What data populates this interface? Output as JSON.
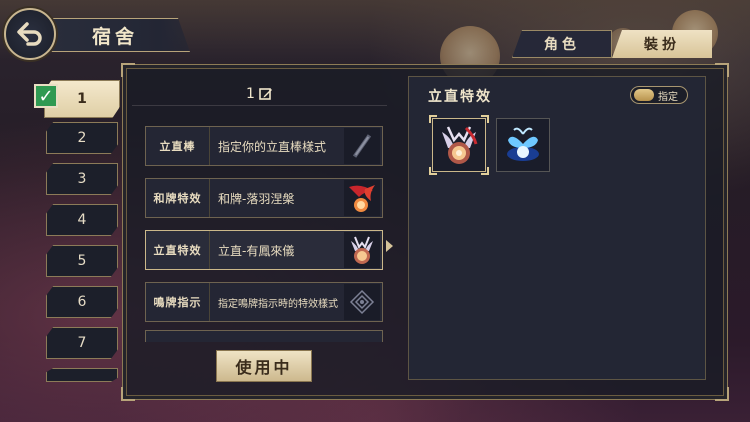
{
  "header": {
    "title": "宿舍"
  },
  "tabs": [
    {
      "label": "角色",
      "active": false
    },
    {
      "label": "裝扮",
      "active": true
    }
  ],
  "slots": [
    {
      "label": "1",
      "active": true
    },
    {
      "label": "2"
    },
    {
      "label": "3"
    },
    {
      "label": "4"
    },
    {
      "label": "5"
    },
    {
      "label": "6"
    },
    {
      "label": "7"
    }
  ],
  "loadout": {
    "name": "1"
  },
  "items": [
    {
      "category": "立直棒",
      "value": "指定你的立直棒樣式",
      "thumb_icon": "stick-icon"
    },
    {
      "category": "和牌特效",
      "value": "和牌-落羽涅槃",
      "thumb_icon": "phoenix-effect-icon"
    },
    {
      "category": "立直特效",
      "value": "立直-有鳳來儀",
      "thumb_icon": "phoenix-orb-icon",
      "selected": true
    },
    {
      "category": "鳴牌指示",
      "value": "指定鳴牌指示時的特效樣式",
      "thumb_icon": "call-indicator-icon"
    }
  ],
  "use_button": {
    "label": "使用中"
  },
  "effect_panel": {
    "title": "立直特效",
    "assign_label": "指定",
    "options": [
      {
        "name": "phoenix-orb-icon",
        "selected": true
      },
      {
        "name": "blue-butterfly-orb-icon",
        "selected": false
      }
    ]
  },
  "colors": {
    "accent_gold": "#cbb88a",
    "panel_dark": "#232634",
    "check_green": "#2f9a52"
  }
}
